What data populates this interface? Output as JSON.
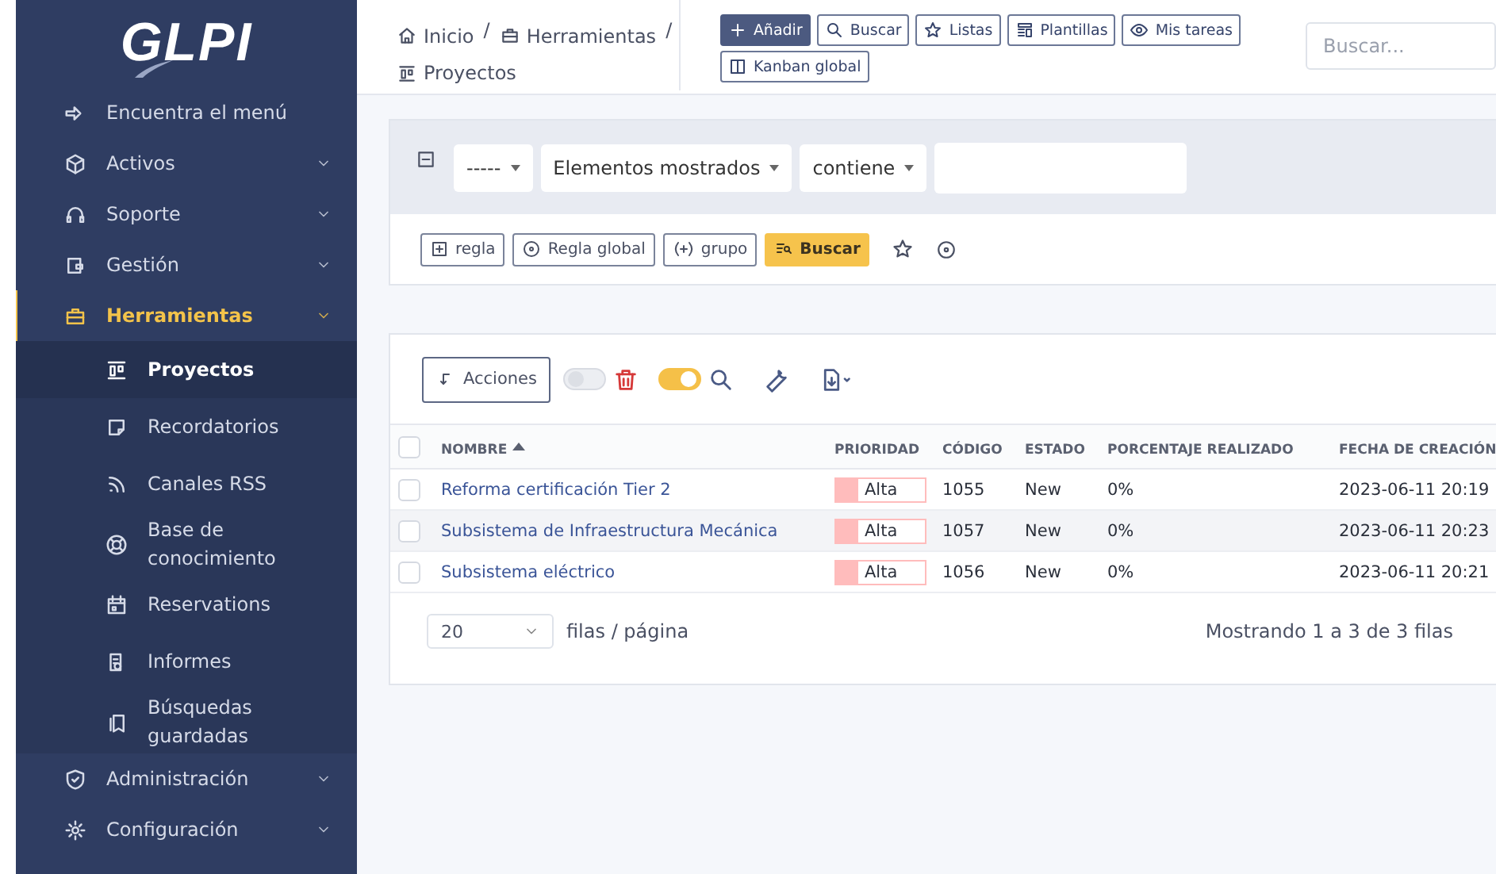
{
  "logo": "GLPI",
  "sidebar": {
    "items": [
      {
        "label": "Encuentra el menú",
        "selected": false
      },
      {
        "label": "Activos",
        "expanded": false,
        "selected": false
      },
      {
        "label": "Soporte",
        "expanded": false,
        "selected": false
      },
      {
        "label": "Gestión",
        "expanded": false,
        "selected": false
      },
      {
        "label": "Herramientas",
        "expanded": true,
        "selected": true,
        "children": [
          {
            "label": "Proyectos",
            "selected": true
          },
          {
            "label": "Recordatorios",
            "selected": false
          },
          {
            "label": "Canales RSS",
            "selected": false
          },
          {
            "label": "Base de conocimiento",
            "selected": false
          },
          {
            "label": "Reservations",
            "selected": false
          },
          {
            "label": "Informes",
            "selected": false
          },
          {
            "label": "Búsquedas guardadas",
            "selected": false
          }
        ]
      },
      {
        "label": "Administración",
        "expanded": false,
        "selected": false
      },
      {
        "label": "Configuración",
        "expanded": false,
        "selected": false
      }
    ]
  },
  "breadcrumb": {
    "separator": "/",
    "items": [
      "Inicio",
      "Herramientas",
      "Proyectos"
    ]
  },
  "toolbar": [
    "Añadir",
    "Buscar",
    "Listas",
    "Plantillas",
    "Mis tareas",
    "Kanban global"
  ],
  "search": {
    "placeholder": "Buscar..."
  },
  "criteria": {
    "field_1": "-----",
    "field_2": "Elementos mostrados",
    "operator": "contiene"
  },
  "criteria_buttons": [
    "regla",
    "Regla global",
    "grupo",
    "Buscar"
  ],
  "actions": {
    "label": "Acciones",
    "toggle_1": {
      "on": false
    },
    "toggle_2": {
      "on": true
    }
  },
  "table": {
    "select_all_checked": false,
    "columns": [
      "NOMBRE",
      "PRIORIDAD",
      "CÓDIGO",
      "ESTADO",
      "PORCENTAJE REALIZADO",
      "FECHA DE CREACIÓN"
    ],
    "rows": [
      {
        "checked": false,
        "name": "Reforma certificación Tier 2",
        "priority": "Alta",
        "color": "#ffbcbc",
        "code": "1055",
        "status": "New",
        "percent": "0%",
        "created": "2023-06-11 20:19"
      },
      {
        "checked": false,
        "name": "Subsistema de Infraestructura Mecánica",
        "priority": "Alta",
        "color": "#ffbcbc",
        "code": "1057",
        "status": "New",
        "percent": "0%",
        "created": "2023-06-11 20:23"
      },
      {
        "checked": false,
        "name": "Subsistema eléctrico",
        "priority": "Alta",
        "color": "#ffbcbc",
        "code": "1056",
        "status": "New",
        "percent": "0%",
        "created": "2023-06-11 20:21"
      }
    ]
  },
  "pager": {
    "per_page": "20",
    "per_page_label": "filas / página",
    "summary": "Mostrando 1 a 3 de 3 filas"
  }
}
